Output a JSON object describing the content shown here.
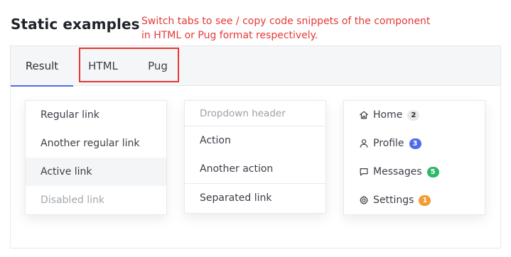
{
  "page": {
    "title": "Static examples",
    "annotation": "Switch tabs to see / copy code snippets of the component in HTML or Pug format respectively."
  },
  "tabs": [
    {
      "label": "Result"
    },
    {
      "label": "HTML"
    },
    {
      "label": "Pug"
    }
  ],
  "links_menu": {
    "items": [
      {
        "label": "Regular link"
      },
      {
        "label": "Another regular link"
      },
      {
        "label": "Active link"
      },
      {
        "label": "Disabled link"
      }
    ]
  },
  "header_menu": {
    "header": "Dropdown header",
    "items": [
      {
        "label": "Action"
      },
      {
        "label": "Another action"
      }
    ],
    "separated_item": "Separated link"
  },
  "icons_menu": {
    "items": [
      {
        "icon": "home-icon",
        "label": "Home",
        "badge": "2",
        "badge_color": "#e7e8ea",
        "badge_text_color": "#2b2f36"
      },
      {
        "icon": "user-icon",
        "label": "Profile",
        "badge": "3",
        "badge_color": "#4f6bed",
        "badge_text_color": "#ffffff"
      },
      {
        "icon": "message-icon",
        "label": "Messages",
        "badge": "5",
        "badge_color": "#2fb86a",
        "badge_text_color": "#ffffff"
      },
      {
        "icon": "gear-icon",
        "label": "Settings",
        "badge": "1",
        "badge_color": "#f39b2f",
        "badge_text_color": "#ffffff"
      }
    ]
  },
  "colors": {
    "accent": "#4f6bed",
    "annotation": "#e53935"
  }
}
